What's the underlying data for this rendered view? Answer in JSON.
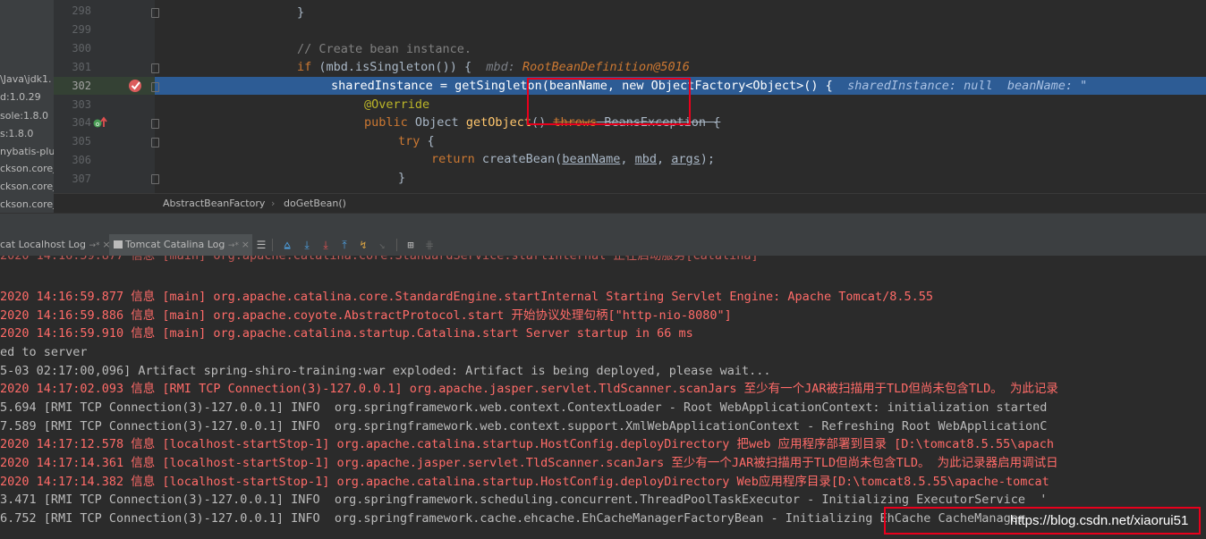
{
  "project_panel": {
    "items": [
      "\\Java\\jdk1.",
      "d:1.0.29",
      "sole:1.8.0",
      "s:1.8.0",
      "nybatis-plus",
      "ckson.corej",
      "ckson.corej",
      "ckson.corej"
    ]
  },
  "editor": {
    "line_numbers": [
      "298",
      "299",
      "300",
      "301",
      "302",
      "303",
      "304",
      "305",
      "306",
      "307"
    ],
    "lines": {
      "l298": "}",
      "l300": "// Create bean instance.",
      "l301_kw": "if",
      "l301_code": " (mbd.isSingleton()) {  ",
      "l301_hint_name": "mbd: ",
      "l301_hint_val": "RootBeanDefinition@5016",
      "l302_code": "sharedInstance = getSingleton(beanName, new ObjectFactory<Object>() {  ",
      "l302_hint": "sharedInstance: null  beanName: \"",
      "l303": "@Override",
      "l304_kw": "public",
      "l304_type": " Object ",
      "l304_fn": "getObject",
      "l304_rest": "() ",
      "l304_throws": "throws",
      "l304_exc": " BeansException {",
      "l305": "try",
      "l305_rest": " {",
      "l306_kw": "return",
      "l306_a": " createBean(",
      "l306_p1": "beanName",
      "l306_c1": ", ",
      "l306_p2": "mbd",
      "l306_c2": ", ",
      "l306_p3": "args",
      "l306_end": ");",
      "l307": "}"
    },
    "breadcrumb": [
      "AbstractBeanFactory",
      "doGetBean()"
    ]
  },
  "tool_tabs": {
    "tab1": "cat Localhost Log",
    "tab2": "Tomcat Catalina Log"
  },
  "console": {
    "lines": [
      {
        "t": "2020 14:16:59.877 信息 [main] org.apache.catalina.core.StandardEngine.startInternal Starting Servlet Engine: Apache Tomcat/8.5.55",
        "c": "r"
      },
      {
        "t": "2020 14:16:59.886 信息 [main] org.apache.coyote.AbstractProtocol.start 开始协议处理句柄[\"http-nio-8080\"]",
        "c": "r"
      },
      {
        "t": "2020 14:16:59.910 信息 [main] org.apache.catalina.startup.Catalina.start Server startup in 66 ms",
        "c": "r"
      },
      {
        "t": "ed to server",
        "c": "w"
      },
      {
        "t": "5-03 02:17:00,096] Artifact spring-shiro-training:war exploded: Artifact is being deployed, please wait...",
        "c": "w"
      },
      {
        "t": "2020 14:17:02.093 信息 [RMI TCP Connection(3)-127.0.0.1] org.apache.jasper.servlet.TldScanner.scanJars 至少有一个JAR被扫描用于TLD但尚未包含TLD。 为此记录",
        "c": "r"
      },
      {
        "t": "5.694 [RMI TCP Connection(3)-127.0.0.1] INFO  org.springframework.web.context.ContextLoader - Root WebApplicationContext: initialization started",
        "c": "w"
      },
      {
        "t": "7.589 [RMI TCP Connection(3)-127.0.0.1] INFO  org.springframework.web.context.support.XmlWebApplicationContext - Refreshing Root WebApplicationC",
        "c": "w"
      },
      {
        "t": "2020 14:17:12.578 信息 [localhost-startStop-1] org.apache.catalina.startup.HostConfig.deployDirectory 把web 应用程序部署到目录 [D:\\tomcat8.5.55\\apach",
        "c": "r"
      },
      {
        "t": "2020 14:17:14.361 信息 [localhost-startStop-1] org.apache.jasper.servlet.TldScanner.scanJars 至少有一个JAR被扫描用于TLD但尚未包含TLD。 为此记录器启用调试日",
        "c": "r"
      },
      {
        "t": "2020 14:17:14.382 信息 [localhost-startStop-1] org.apache.catalina.startup.HostConfig.deployDirectory Web应用程序目录[D:\\tomcat8.5.55\\apache-tomcat",
        "c": "r"
      },
      {
        "t": "3.471 [RMI TCP Connection(3)-127.0.0.1] INFO  org.springframework.scheduling.concurrent.ThreadPoolTaskExecutor - Initializing ExecutorService  '",
        "c": "w"
      },
      {
        "t": "6.752 [RMI TCP Connection(3)-127.0.0.1] INFO  org.springframework.cache.ehcache.EhCacheManagerFactoryBean - Initializing EhCache CacheManager",
        "c": "w"
      }
    ]
  },
  "watermark": "https://blog.csdn.net/xiaorui51",
  "colors": {
    "accent_highlight": "#2d5c95",
    "annotation_red": "#e8001c",
    "log_red": "#ff6b68"
  }
}
